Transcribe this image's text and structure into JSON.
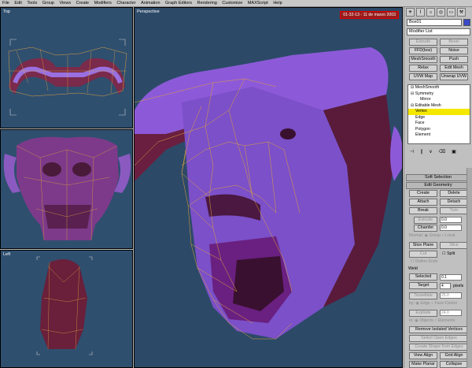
{
  "menu": [
    "File",
    "Edit",
    "Tools",
    "Group",
    "Views",
    "Create",
    "Modifiers",
    "Character",
    "Animation",
    "Graph Editors",
    "Rendering",
    "Customize",
    "MAXScript",
    "Help"
  ],
  "viewports": {
    "top_label": "Top",
    "front_label": "",
    "left_label": "Left",
    "persp_label": "Perspective",
    "date": "01-32-13 - 11 de marzo 2003"
  },
  "panel": {
    "object_name": "Box01",
    "modifier_list": "Modifier List",
    "buttons": [
      [
        "Extrude",
        "Bevel"
      ],
      [
        "FFD(box)",
        "Noise"
      ],
      [
        "MeshSmooth",
        "Push"
      ],
      [
        "Relax",
        "Edit Mesh"
      ],
      [
        "UVW Map",
        "Unwrap UVW"
      ]
    ],
    "stack": [
      {
        "text": "MeshSmooth",
        "indent": 0,
        "hl": false
      },
      {
        "text": "Symmetry",
        "indent": 0,
        "hl": false
      },
      {
        "text": "Mirror",
        "indent": 2,
        "hl": false
      },
      {
        "text": "Editable Mesh",
        "indent": 0,
        "hl": false
      },
      {
        "text": "Vertex",
        "indent": 1,
        "hl": true
      },
      {
        "text": "Edge",
        "indent": 1,
        "hl": false
      },
      {
        "text": "Face",
        "indent": 1,
        "hl": false
      },
      {
        "text": "Polygon",
        "indent": 1,
        "hl": false
      },
      {
        "text": "Element",
        "indent": 1,
        "hl": false
      }
    ],
    "soft_selection": "Soft Selection",
    "edit_geometry": "Edit Geometry",
    "create": "Create",
    "delete": "Delete",
    "attach": "Attach",
    "detach": "Detach",
    "break": "Break",
    "turn": "Turn",
    "extrude": "Extrude",
    "extrude_val": "0.0",
    "chamfer": "Chamfer",
    "chamfer_val": "0.0",
    "normal": "Normal",
    "group": "Group",
    "local": "Local",
    "slice_plane": "Slice Plane",
    "slice": "Slice",
    "cut": "Cut",
    "split": "Split",
    "refine_ends": "Refine Ends",
    "weld": "Weld",
    "selected": "Selected",
    "selected_val": "0.1",
    "target": "Target",
    "target_val": "4",
    "pixels": "pixels",
    "tessellate": "Tessellate",
    "tess_val": "25.0",
    "by": "by",
    "edge_opt": "Edge",
    "face_center": "Face-Center",
    "explode": "Explode",
    "explode_val": "24.0",
    "to": "to",
    "objects": "Objects",
    "elements": "Elements",
    "remove_isolated": "Remove Isolated Vertices",
    "select_open_edges": "Select Open Edges",
    "create_shape": "Create Shape from Edges",
    "view_align": "View Align",
    "grid_align": "Grid Align",
    "make_planar": "Make Planar",
    "collapse": "Collapse"
  }
}
